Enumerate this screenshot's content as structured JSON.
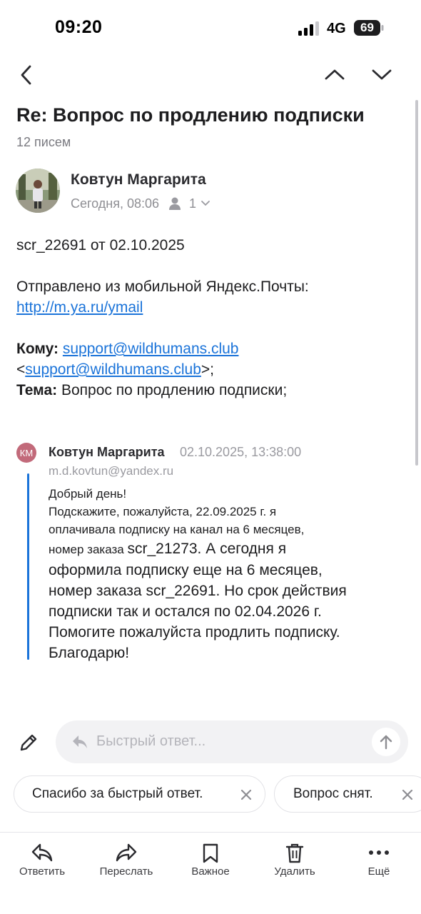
{
  "status_bar": {
    "time": "09:20",
    "network": "4G",
    "battery": "69"
  },
  "nav": {
    "back_icon": "chevron-left-icon",
    "prev_icon": "chevron-up-icon",
    "next_icon": "chevron-down-icon"
  },
  "thread": {
    "subject": "Re: Вопрос по продлению подписки",
    "count": "12 писем"
  },
  "message": {
    "sender": "Ковтун Маргарита",
    "date": "Сегодня, 08:06",
    "recipients_count": "1",
    "body": {
      "line1": "scr_22691 от 02.10.2025",
      "sent_from": "Отправлено из мобильной Яндекс.Почты:",
      "link": "http://m.ya.ru/ymail",
      "to_label": "Кому:",
      "to_email": "support@wildhumans.club",
      "to_bracket_open": "<",
      "to_email2": "support@wildhumans.club",
      "to_bracket_close": ">;",
      "subject_label": "Тема:",
      "subject_value": "Вопрос по продлению подписки;"
    }
  },
  "quoted": {
    "initials": "КМ",
    "sender": "Ковтун Маргарита",
    "date": "02.10.2025, 13:38:00",
    "email": "m.d.kovtun@yandex.ru",
    "lines_small": [
      "Добрый день!",
      "Подскажите, пожалуйста, 22.09.2025 г. я",
      "оплачивала подписку на канал на 6 месяцев,",
      "номер заказа"
    ],
    "order1": "scr_21273. А сегодня я",
    "lines_big": [
      "оформила подписку еще на 6 месяцев,",
      "номер заказа scr_22691. Но срок действия",
      "подписки так и остался по 02.04.2026 г.",
      "Помогите пожалуйста продлить подписку.",
      "Благодарю!"
    ]
  },
  "reply": {
    "placeholder": "Быстрый ответ..."
  },
  "chips": [
    {
      "label": "Спасибо за быстрый ответ."
    },
    {
      "label": "Вопрос снят."
    }
  ],
  "tabbar": [
    {
      "label": "Ответить",
      "icon": "reply-icon"
    },
    {
      "label": "Переслать",
      "icon": "forward-icon"
    },
    {
      "label": "Важное",
      "icon": "bookmark-icon"
    },
    {
      "label": "Удалить",
      "icon": "trash-icon"
    },
    {
      "label": "Ещё",
      "icon": "more-icon"
    }
  ],
  "colors": {
    "link": "#1a73d9",
    "quote_bar": "#1a73d9",
    "quoted_avatar": "#c26a7a"
  }
}
